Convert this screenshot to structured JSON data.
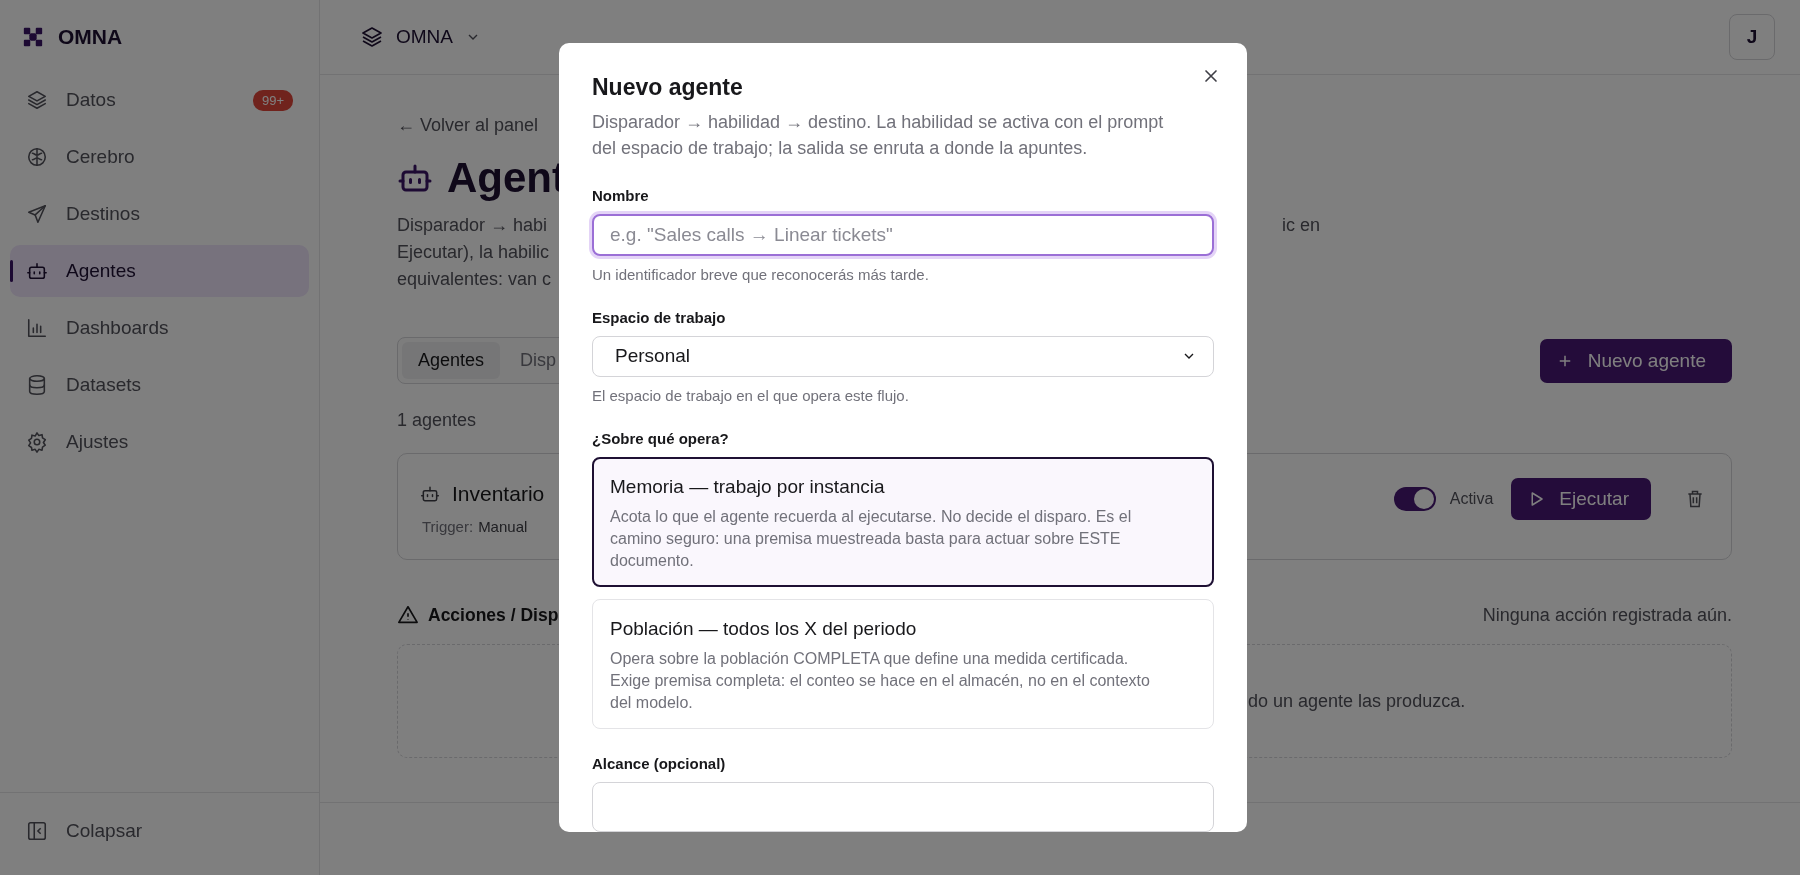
{
  "sidebar": {
    "brand": "OMNA",
    "items": [
      {
        "label": "Datos",
        "badge": "99+",
        "selected": false
      },
      {
        "label": "Cerebro",
        "selected": false
      },
      {
        "label": "Destinos",
        "selected": false
      },
      {
        "label": "Agentes",
        "selected": true
      },
      {
        "label": "Dashboards",
        "selected": false
      },
      {
        "label": "Datasets",
        "selected": false
      },
      {
        "label": "Ajustes",
        "selected": false
      }
    ],
    "collapse": "Colapsar"
  },
  "topbar": {
    "workspace": "OMNA",
    "avatar": "J"
  },
  "page": {
    "back_link": "← Volver al panel",
    "title": "Agent",
    "description_left": [
      "Disparador → habi",
      "Ejecutar), la habilic",
      "equivalentes: van c"
    ],
    "description_right": "ic en",
    "tabs": [
      {
        "label": "Agentes",
        "selected": true
      },
      {
        "label": "Disp",
        "selected": false
      }
    ],
    "new_button": "Nuevo agente",
    "count": "1 agentes",
    "agent": {
      "name": "Inventario",
      "trigger_label": "Trigger:",
      "trigger": "Manual",
      "active": true,
      "active_label": "Activa",
      "run_button": "Ejecutar"
    },
    "actions": {
      "title": "Acciones / Disp",
      "empty": "Ninguna acción registrada aún.",
      "empty_hint": "do un agente las produzca."
    }
  },
  "modal": {
    "title": "Nuevo agente",
    "description": "Disparador → habilidad → destino. La habilidad se activa con el prompt del espacio de trabajo; la salida se enruta a donde la apuntes.",
    "name_field": {
      "label": "Nombre",
      "placeholder": "e.g. \"Sales calls → Linear tickets\"",
      "focused": true,
      "hint": "Un identificador breve que reconocerás más tarde."
    },
    "workspace_field": {
      "label": "Espacio de trabajo",
      "value": "Personal",
      "hint": "El espacio de trabajo en el que opera este flujo."
    },
    "operate": {
      "label": "¿Sobre qué opera?",
      "options": [
        {
          "title": "Memoria — trabajo por instancia",
          "description": "Acota lo que el agente recuerda al ejecutarse. No decide el disparo. Es el camino seguro: una premisa muestreada basta para actuar sobre ESTE documento.",
          "selected": true
        },
        {
          "title": "Población — todos los X del periodo",
          "description": "Opera sobre la población COMPLETA que define una medida certificada. Exige premisa completa: el conteo se hace en el almacén, no en el contexto del modelo.",
          "selected": false
        }
      ]
    },
    "scope_field": {
      "label": "Alcance (opcional)"
    }
  }
}
